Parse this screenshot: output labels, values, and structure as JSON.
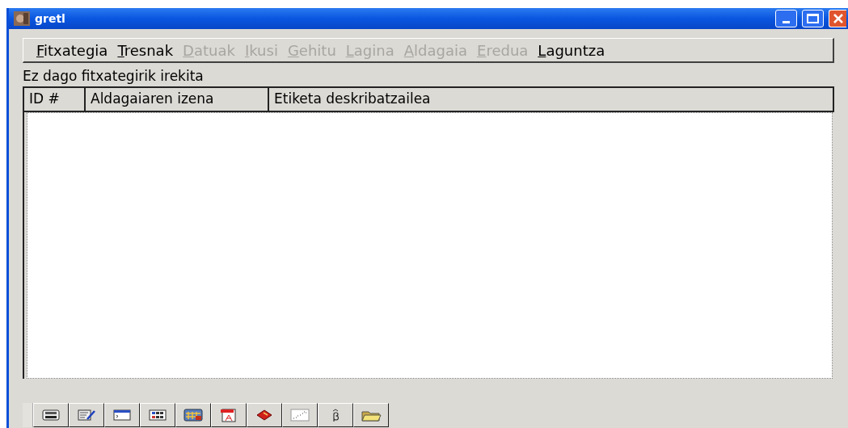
{
  "window": {
    "title": "gretl"
  },
  "menu": [
    {
      "label": "Fitxategia",
      "disabled": false
    },
    {
      "label": "Tresnak",
      "disabled": false
    },
    {
      "label": "Datuak",
      "disabled": true
    },
    {
      "label": "Ikusi",
      "disabled": true
    },
    {
      "label": "Gehitu",
      "disabled": true
    },
    {
      "label": "Lagina",
      "disabled": true
    },
    {
      "label": "Aldagaia",
      "disabled": true
    },
    {
      "label": "Eredua",
      "disabled": true
    },
    {
      "label": "Laguntza",
      "disabled": false
    }
  ],
  "status": "Ez dago fitxategirik irekita",
  "table": {
    "columns": [
      "ID #",
      "Aldagaiaren izena",
      "Etiketa deskribatzailea"
    ]
  }
}
